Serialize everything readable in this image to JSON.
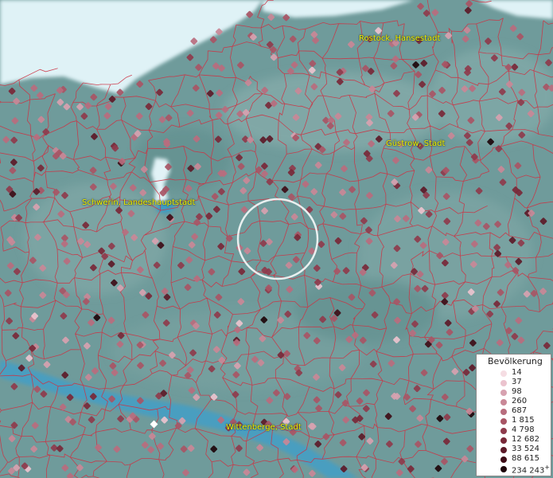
{
  "map": {
    "colors": {
      "land": "#6f9b9b",
      "water": "#dff2f6",
      "river": "#4a9ec0",
      "borders": "#cc3344",
      "selection_ring": "#ffffff",
      "label": "#f2f200"
    },
    "places": [
      {
        "name": "Rostock, Hansestadt"
      },
      {
        "name": "Güstrow, Stadt"
      },
      {
        "name": "Schwerin, Landeshauptstadt"
      },
      {
        "name": "Wittenberge, Stadt"
      }
    ]
  },
  "legend": {
    "title": "Bevölkerung",
    "classes": [
      {
        "label": "14",
        "color": "#f5dde3"
      },
      {
        "label": "37",
        "color": "#ebc3ce"
      },
      {
        "label": "98",
        "color": "#d7a2b0"
      },
      {
        "label": "260",
        "color": "#c98897"
      },
      {
        "label": "687",
        "color": "#b86d7e"
      },
      {
        "label": "1 815",
        "color": "#a85565"
      },
      {
        "label": "4 798",
        "color": "#8e3b4c"
      },
      {
        "label": "12 682",
        "color": "#782838"
      },
      {
        "label": "33 524",
        "color": "#5c1a28"
      },
      {
        "label": "88 615",
        "color": "#3e0d17"
      },
      {
        "label": "234 243",
        "color": "#1d050a"
      }
    ],
    "overflow_mark": "+"
  }
}
